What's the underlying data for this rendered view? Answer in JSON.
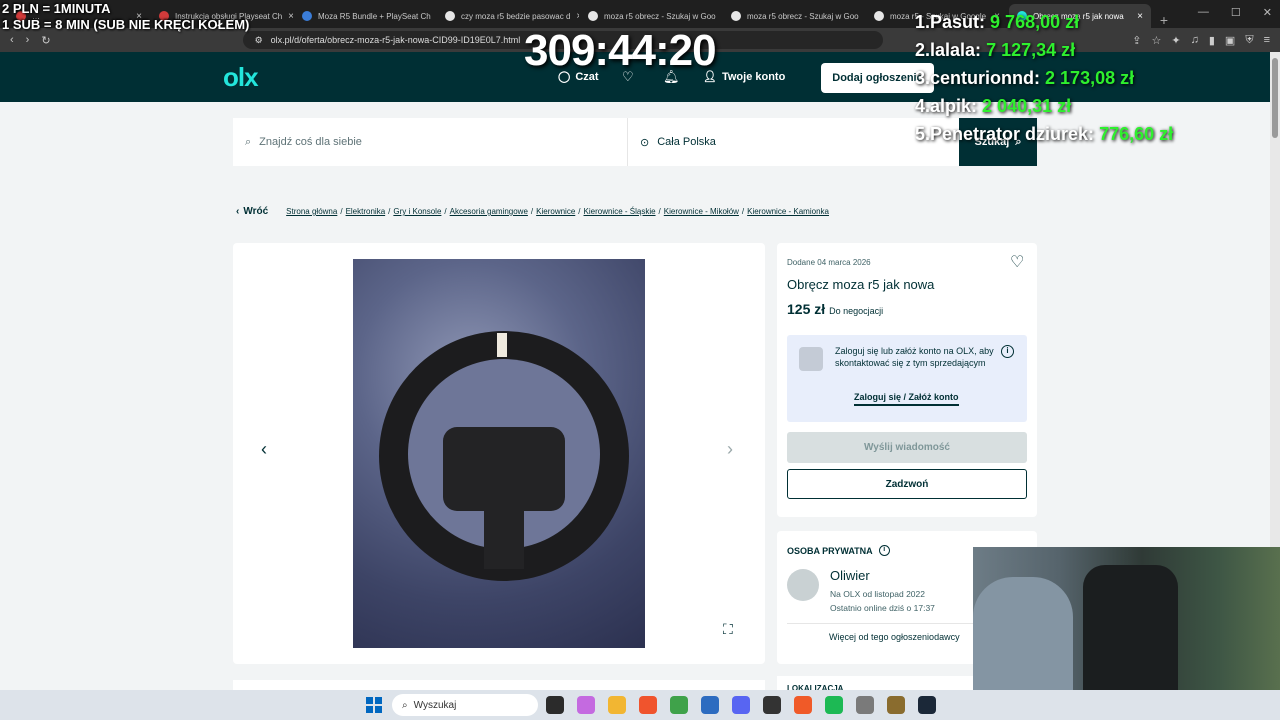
{
  "browser": {
    "tabs": [
      {
        "label": "…",
        "fav": "#d23b3b"
      },
      {
        "label": "Instrukcja obsługi Playseat Ch",
        "fav": "#d23b3b"
      },
      {
        "label": "Moza R5 Bundle + PlaySeat Ch",
        "fav": "#3b7dd8"
      },
      {
        "label": "czy moza r5 bedzie pasowac d",
        "fav": "#e6e6e6"
      },
      {
        "label": "moza r5 obrecz - Szukaj w Goo",
        "fav": "#e6e6e6"
      },
      {
        "label": "moza r5 obrecz - Szukaj w Goo",
        "fav": "#e6e6e6"
      },
      {
        "label": "moza r5 - Szukaj w Google",
        "fav": "#e6e6e6"
      },
      {
        "label": "Obręcz moza r5 jak nowa",
        "fav": "#23e5db"
      }
    ],
    "new_tab": "+",
    "url": "olx.pl/d/oferta/obrecz-moza-r5-jak-nowa-CID99-ID19E0L7.html"
  },
  "header": {
    "logo": "olx",
    "chat": "Czat",
    "account": "Twoje konto",
    "add_ad": "Dodaj ogłoszenie"
  },
  "search": {
    "placeholder": "Znajdź coś dla siebie",
    "location": "Cała Polska",
    "button": "Szukaj"
  },
  "breadcrumb": {
    "back": "Wróć",
    "items": [
      "Strona główna",
      "Elektronika",
      "Gry i Konsole",
      "Akcesoria gamingowe",
      "Kierownice",
      "Kierownice - Śląskie",
      "Kierownice - Mikołów",
      "Kierownice - Kamionka"
    ]
  },
  "ad": {
    "added": "Dodane 04 marca 2026",
    "title": "Obręcz moza r5 jak nowa",
    "price": "125 zł",
    "negotiable": "Do negocjacji",
    "login_text": "Zaloguj się lub załóż konto na OLX, aby skontaktować się z tym sprzedającym",
    "login_link": "Zaloguj się / Załóż konto",
    "message_btn": "Wyślij wiadomość",
    "call_btn": "Zadzwoń"
  },
  "seller": {
    "heading": "OSOBA PRYWATNA",
    "name": "Oliwier",
    "since": "Na OLX od listopad 2022",
    "online": "Ostatnio online dziś o 17:37",
    "more": "Więcej od tego ogłoszeniodawcy"
  },
  "location_card": "LOKALIZACJA",
  "overlay": {
    "line1": "2 PLN =  1MINUTA",
    "line2": "1 SUB = 8 MIN (SUB NIE KRĘCI KOŁEM)",
    "timer": "309:44:20",
    "leaderboard": [
      {
        "rank": "1.",
        "name": "Pasut:",
        "amount": "9 768,00 zł"
      },
      {
        "rank": "2.",
        "name": "lalala:",
        "amount": "7 127,34 zł"
      },
      {
        "rank": "3.",
        "name": "centurionnd:",
        "amount": "2 173,08 zł"
      },
      {
        "rank": "4.",
        "name": "alpik:",
        "amount": "2 040,31 zł"
      },
      {
        "rank": "5.",
        "name": "Penetrator dziurek:",
        "amount": "776,60 zł"
      }
    ]
  },
  "taskbar": {
    "search_placeholder": "Wyszukaj"
  }
}
